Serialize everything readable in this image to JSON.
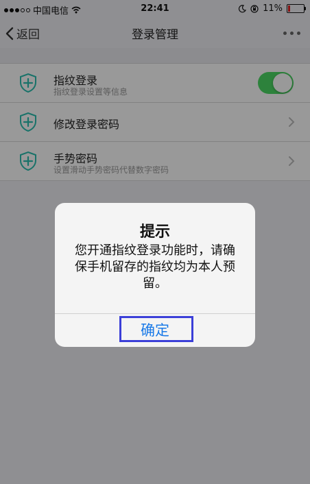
{
  "status_bar": {
    "carrier": "中国电信",
    "time": "22:41",
    "battery_percent": "11%"
  },
  "nav": {
    "back_label": "返回",
    "title": "登录管理"
  },
  "settings": {
    "items": [
      {
        "title": "指纹登录",
        "subtitle": "指纹登录设置等信息",
        "control": "toggle-on"
      },
      {
        "title": "修改登录密码",
        "control": "chevron"
      },
      {
        "title": "手势密码",
        "subtitle": "设置滑动手势密码代替数字密码",
        "control": "chevron"
      }
    ]
  },
  "alert": {
    "title": "提示",
    "message": "您开通指纹登录功能时，请确保手机留存的指纹均为本人预留。",
    "confirm_label": "确定"
  },
  "colors": {
    "toggle_on": "#4cd964",
    "icon_teal": "#2bbfb0",
    "alert_button": "#1a7ae8",
    "highlight_box": "#3b3fd8"
  }
}
